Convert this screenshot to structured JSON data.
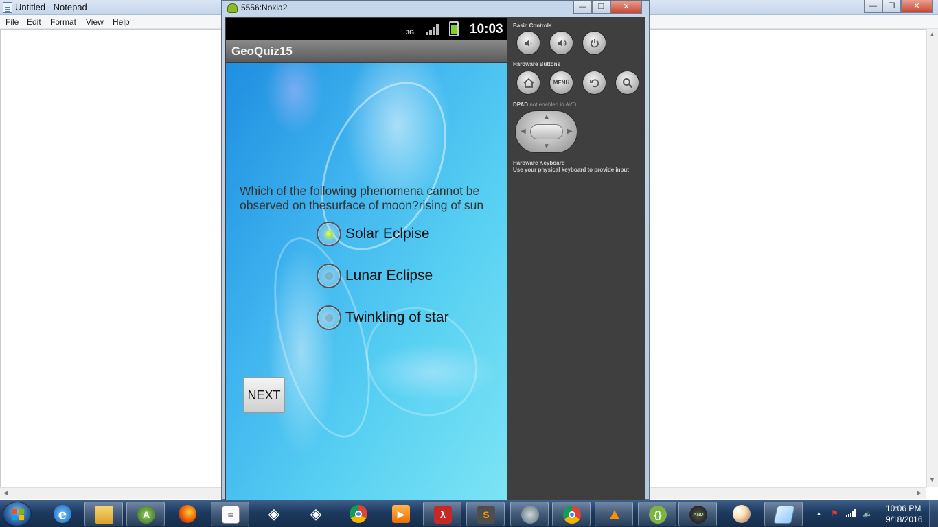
{
  "notepad": {
    "title": "Untitled - Notepad",
    "menu": [
      "File",
      "Edit",
      "Format",
      "View",
      "Help"
    ],
    "caption_buttons": [
      "minimize",
      "maximize",
      "close"
    ]
  },
  "emulator": {
    "title": "5556:Nokia2",
    "status_bar": {
      "network": "3G",
      "time": "10:03"
    },
    "app": {
      "title": "GeoQuiz15",
      "question": "Which of the following phenomena cannot be observed on thesurface of moon?rising of sun",
      "options": [
        {
          "label": "Solar Eclpise",
          "checked": true
        },
        {
          "label": "Lunar Eclipse",
          "checked": false
        },
        {
          "label": "Twinkling of star",
          "checked": false
        }
      ],
      "next_label": "NEXT"
    },
    "controls": {
      "basic_heading": "Basic Controls",
      "hardware_heading": "Hardware Buttons",
      "menu_label": "MENU",
      "dpad_heading": "DPAD",
      "dpad_note": "not enabled in AVD",
      "keyboard_heading": "Hardware Keyboard",
      "keyboard_note": "Use your physical keyboard to provide input"
    }
  },
  "taskbar": {
    "items": [
      "internet-explorer",
      "file-explorer",
      "android-studio",
      "firefox",
      "notepad",
      "unity",
      "unity",
      "chrome",
      "media-player",
      "adobe-reader",
      "sublime-text",
      "emulator",
      "chrome",
      "vlc",
      "brackets",
      "android-sdk",
      "paint",
      "notepad-active"
    ],
    "clock_time": "10:06 PM",
    "clock_date": "9/18/2016"
  }
}
